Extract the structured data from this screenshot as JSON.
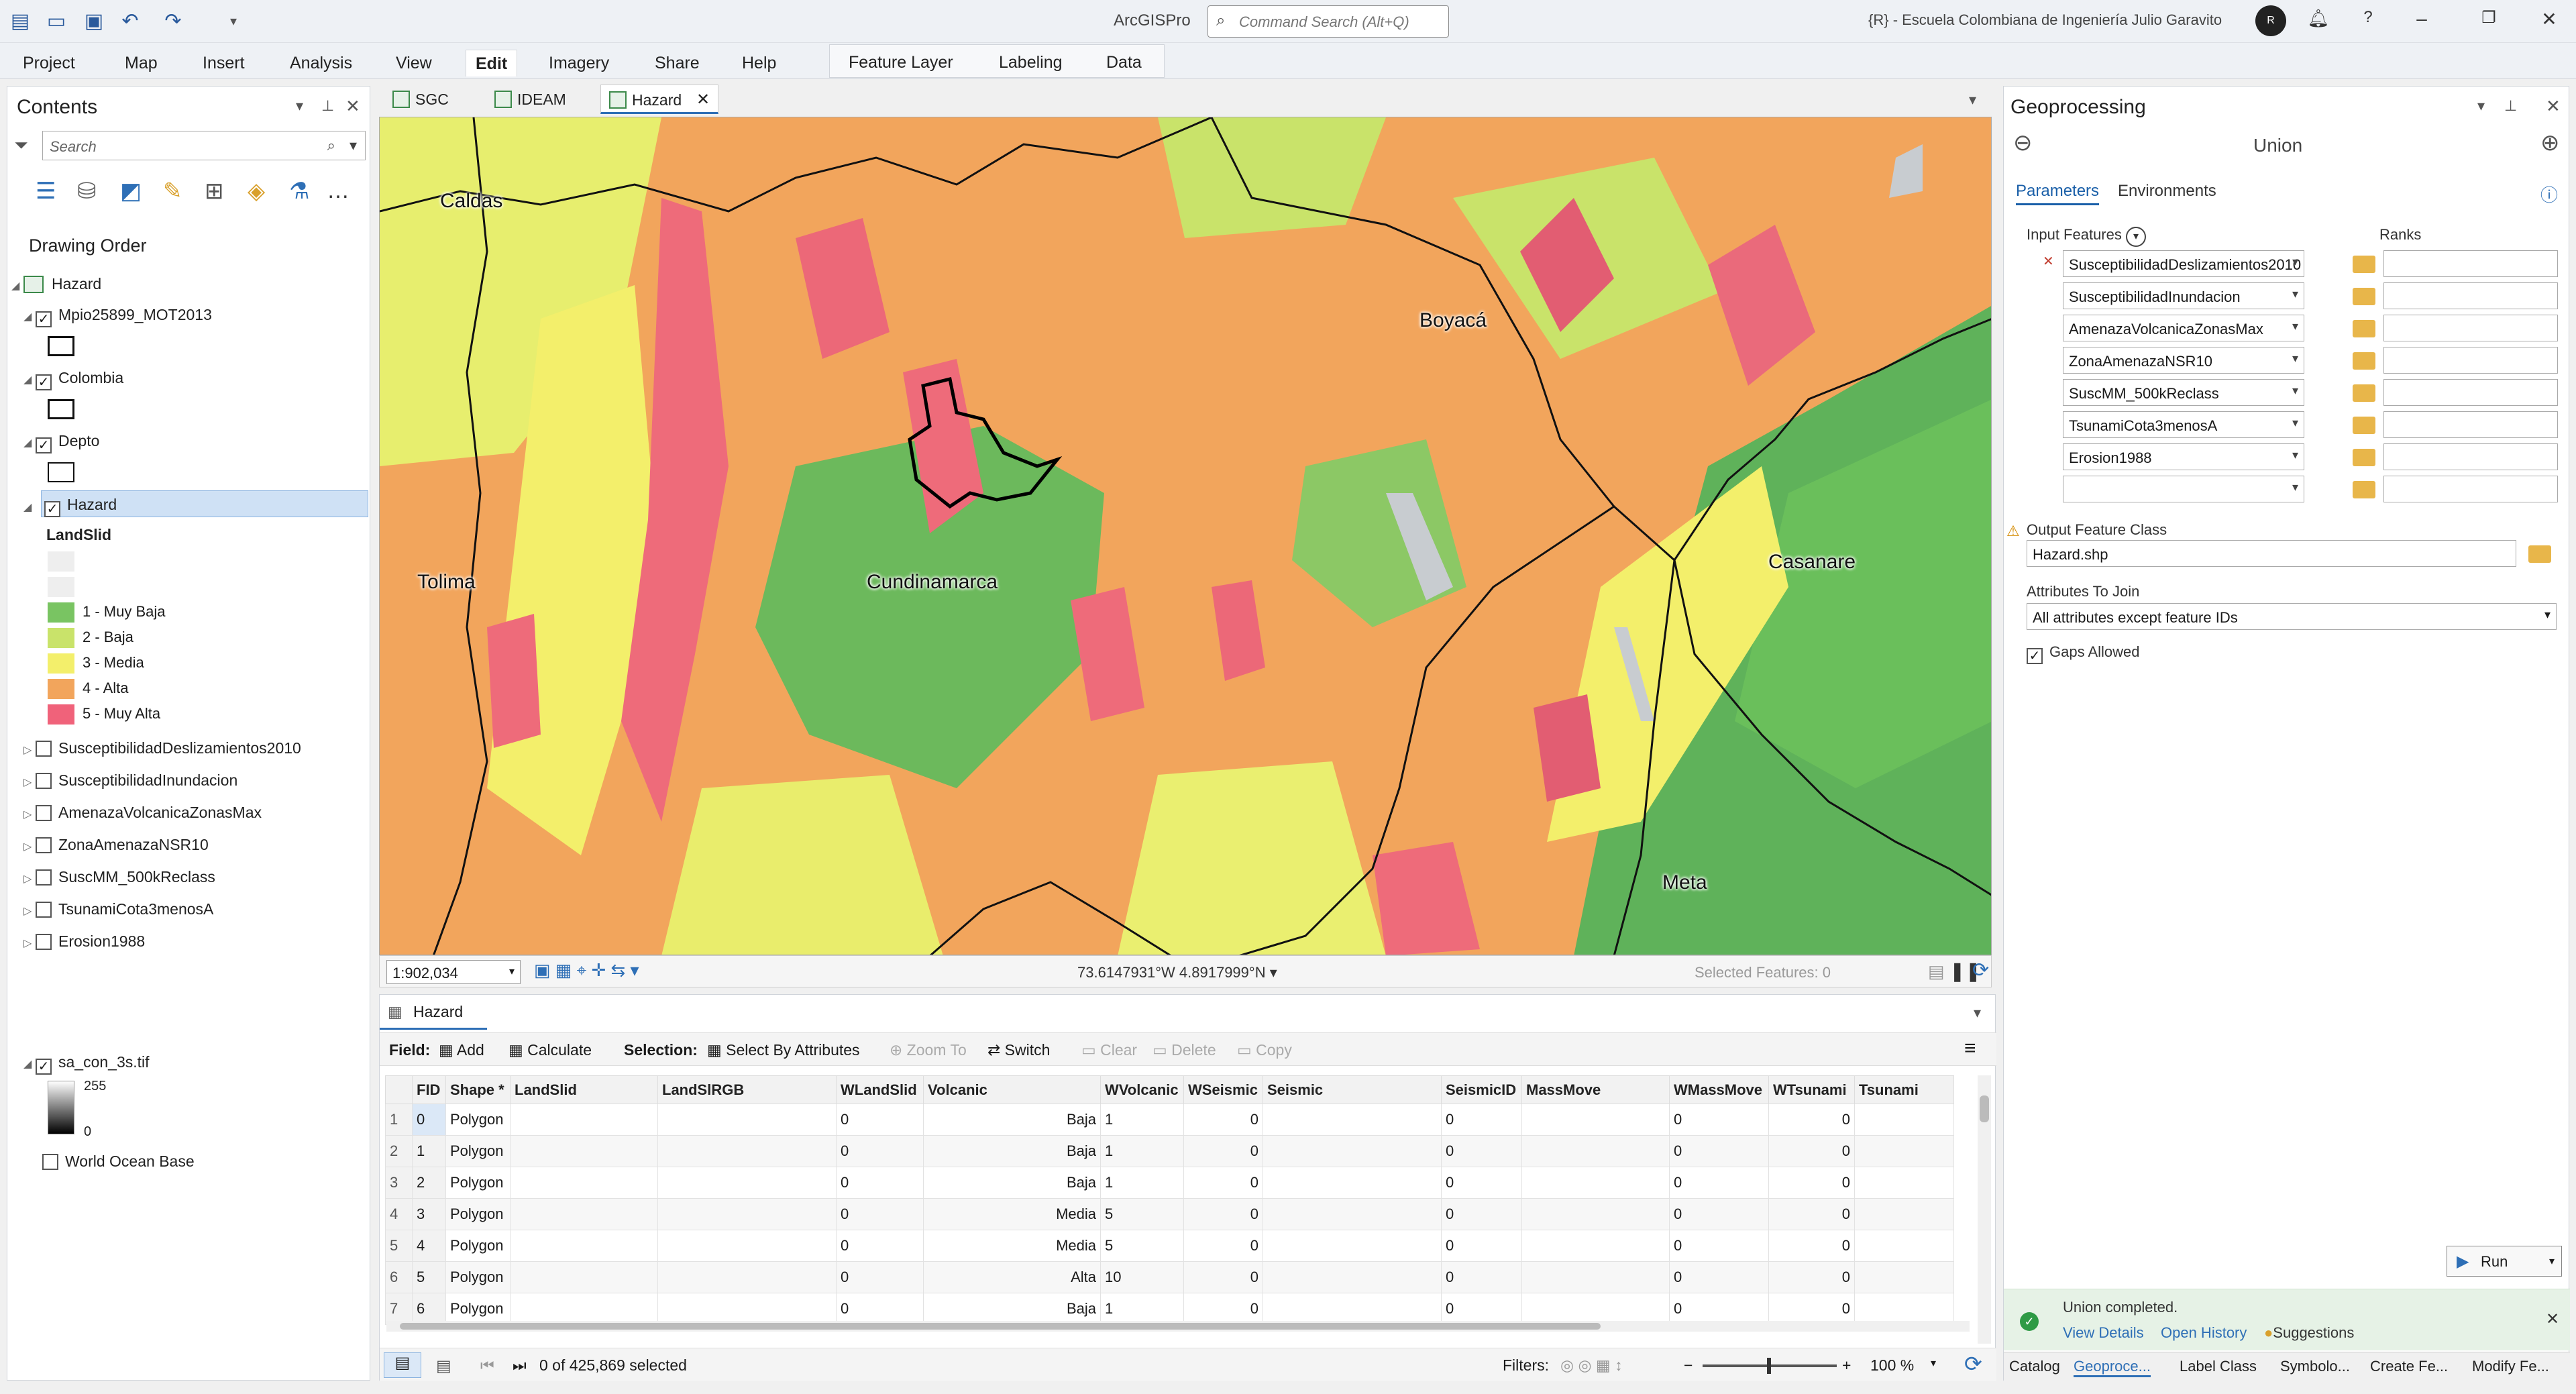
{
  "app": {
    "title": "ArcGISPro",
    "org": "{R} - Escuela Colombiana de Ingeniería Julio Garavito",
    "avatar": "R"
  },
  "command_search": {
    "placeholder": "Command Search (Alt+Q)"
  },
  "ribbon": {
    "tabs": [
      "Project",
      "Map",
      "Insert",
      "Analysis",
      "View",
      "Edit",
      "Imagery",
      "Share",
      "Help"
    ],
    "active": "Edit",
    "contextual": [
      "Feature Layer",
      "Labeling",
      "Data"
    ]
  },
  "contents": {
    "title": "Contents",
    "search_placeholder": "Search",
    "drawing_order": "Drawing Order",
    "root": "Hazard",
    "layers": [
      {
        "name": "Mpio25899_MOT2013",
        "checked": true
      },
      {
        "name": "Colombia",
        "checked": true
      },
      {
        "name": "Depto",
        "checked": true
      },
      {
        "name": "Hazard",
        "checked": true
      }
    ],
    "legend_field": "LandSlid",
    "legend": [
      {
        "label": "1 - Muy Baja",
        "color": "#79c462"
      },
      {
        "label": "2 - Baja",
        "color": "#c9e36a"
      },
      {
        "label": "3 - Media",
        "color": "#f3ef6b"
      },
      {
        "label": "4 - Alta",
        "color": "#f2a55c"
      },
      {
        "label": "5 - Muy Alta",
        "color": "#f0627a"
      }
    ],
    "other_layers": [
      "SusceptibilidadDeslizamientos2010",
      "SusceptibilidadInundacion",
      "AmenazaVolcanicaZonasMax",
      "ZonaAmenazaNSR10",
      "SuscMM_500kReclass",
      "TsunamiCota3menosA",
      "Erosion1988"
    ],
    "raster": {
      "name": "sa_con_3s.tif",
      "max": "255",
      "min": "0"
    },
    "basemap": "World Ocean Base"
  },
  "map_tabs": [
    "SGC",
    "IDEAM",
    "Hazard"
  ],
  "map": {
    "labels": [
      "Caldas",
      "Boyacá",
      "Tolima",
      "Cundinamarca",
      "Casanare",
      "Meta"
    ],
    "scale": "1:902,034",
    "coordinates": "73.6147931°W 4.8917999°N",
    "selected_features": "Selected Features: 0"
  },
  "table": {
    "tab": "Hazard",
    "field_label": "Field:",
    "add": "Add",
    "calculate": "Calculate",
    "selection_label": "Selection:",
    "select_by_attributes": "Select By Attributes",
    "zoom_to": "Zoom To",
    "switch": "Switch",
    "clear": "Clear",
    "delete": "Delete",
    "copy": "Copy",
    "columns": [
      "FID",
      "Shape *",
      "LandSlid",
      "LandSlRGB",
      "WLandSlid",
      "Volcanic",
      "WVolcanic",
      "WSeismic",
      "Seismic",
      "SeismicID",
      "MassMove",
      "WMassMove",
      "WTsunami",
      "Tsunami"
    ],
    "rows": [
      [
        "1",
        "0",
        "Polygon",
        "",
        "",
        "0",
        "Baja",
        "1",
        "0",
        "",
        "0",
        "",
        "0",
        "0"
      ],
      [
        "2",
        "1",
        "Polygon",
        "",
        "",
        "0",
        "Baja",
        "1",
        "0",
        "",
        "0",
        "",
        "0",
        "0"
      ],
      [
        "3",
        "2",
        "Polygon",
        "",
        "",
        "0",
        "Baja",
        "1",
        "0",
        "",
        "0",
        "",
        "0",
        "0"
      ],
      [
        "4",
        "3",
        "Polygon",
        "",
        "",
        "0",
        "Media",
        "5",
        "0",
        "",
        "0",
        "",
        "0",
        "0"
      ],
      [
        "5",
        "4",
        "Polygon",
        "",
        "",
        "0",
        "Media",
        "5",
        "0",
        "",
        "0",
        "",
        "0",
        "0"
      ],
      [
        "6",
        "5",
        "Polygon",
        "",
        "",
        "0",
        "Alta",
        "10",
        "0",
        "",
        "0",
        "",
        "0",
        "0"
      ],
      [
        "7",
        "6",
        "Polygon",
        "",
        "",
        "0",
        "Baja",
        "1",
        "0",
        "",
        "0",
        "",
        "0",
        "0"
      ]
    ],
    "selected_status": "0 of 425,869 selected",
    "filters": "Filters:",
    "zoom": "100 %"
  },
  "geoprocessing": {
    "title": "Geoprocessing",
    "tool": "Union",
    "tabs": [
      "Parameters",
      "Environments"
    ],
    "input_features_label": "Input Features",
    "ranks_label": "Ranks",
    "inputs": [
      "SusceptibilidadDeslizamientos2010",
      "SusceptibilidadInundacion",
      "AmenazaVolcanicaZonasMax",
      "ZonaAmenazaNSR10",
      "SuscMM_500kReclass",
      "TsunamiCota3menosA",
      "Erosion1988",
      ""
    ],
    "output_label": "Output Feature Class",
    "output_value": "Hazard.shp",
    "attributes_label": "Attributes To Join",
    "attributes_value": "All attributes except feature IDs",
    "gaps_label": "Gaps Allowed",
    "run": "Run",
    "notification": "Union completed.",
    "links": [
      "View Details",
      "Open History",
      "Suggestions"
    ],
    "bottom_tabs": [
      "Catalog",
      "Geoproce...",
      "Label Class",
      "Symbolo...",
      "Create Fe...",
      "Modify Fe..."
    ]
  }
}
